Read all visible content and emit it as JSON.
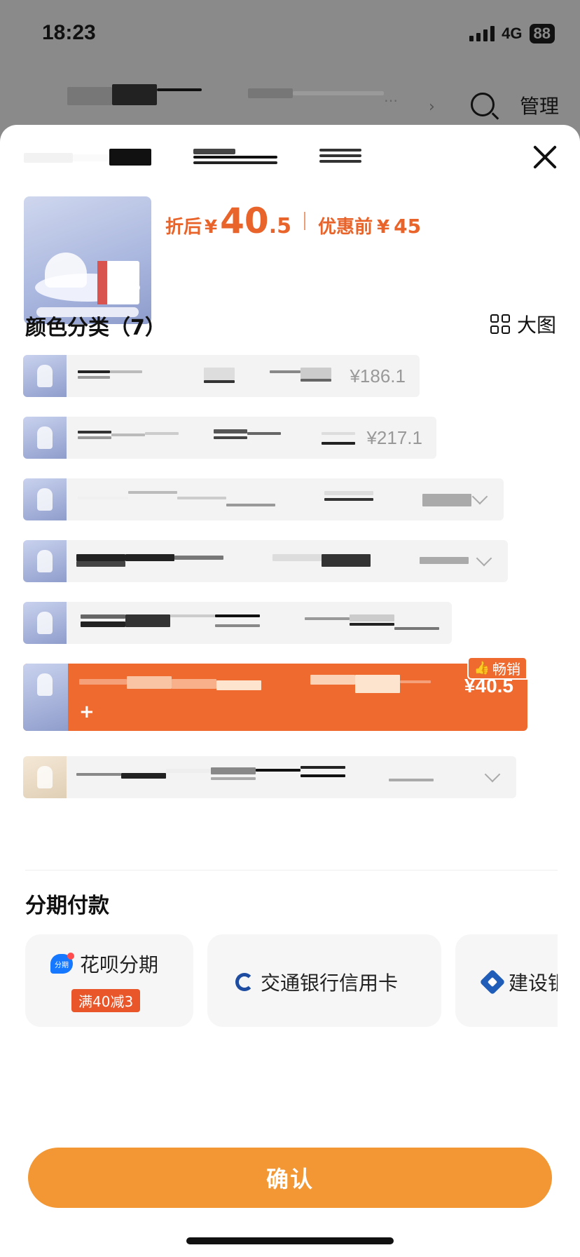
{
  "status_bar": {
    "time": "18:23",
    "network": "4G",
    "battery": "88"
  },
  "background_nav": {
    "manage_label": "管理",
    "chevron": "›",
    "ellipsis": "…"
  },
  "product": {
    "price_label": "折后",
    "currency": "¥",
    "price_int": "40",
    "price_dec": ".5",
    "original_label": "优惠前",
    "original_price": "45"
  },
  "variants": {
    "title": "颜色分类（7）",
    "view_toggle_label": "大图",
    "items": [
      {
        "price": "¥186.1"
      },
      {
        "price": "¥217.1"
      },
      {
        "price": ""
      },
      {
        "price": ""
      },
      {
        "price": ""
      },
      {
        "price": "¥40.5",
        "selected": true,
        "badge": "畅销",
        "plus": "+"
      },
      {
        "price": ""
      }
    ]
  },
  "installments": {
    "title": "分期付款",
    "options": [
      {
        "label": "花呗分期",
        "promo": "满40减3",
        "icon": "alipay-huabei-icon",
        "icon_text": "分期"
      },
      {
        "label": "交通银行信用卡",
        "icon": "bocom-icon"
      },
      {
        "label": "建设银行",
        "icon": "ccb-icon"
      }
    ]
  },
  "confirm_label": "确认",
  "colors": {
    "accent": "#ee6a2e",
    "confirm": "#f29733",
    "price": "#e8642a"
  }
}
